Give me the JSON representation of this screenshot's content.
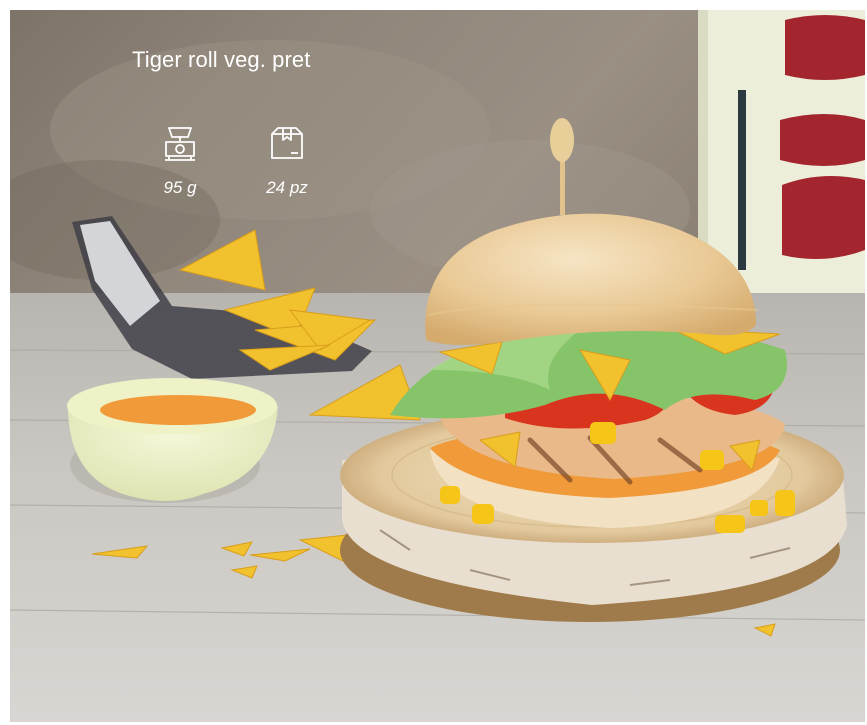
{
  "product": {
    "title": "Tiger roll veg. pret",
    "specs": [
      {
        "icon": "scale-icon",
        "value": "95 g"
      },
      {
        "icon": "box-icon",
        "value": "24 pz"
      }
    ]
  },
  "photo": {
    "subject": "burger-photo",
    "colors": {
      "wall": "#8d8478",
      "table": "#c9c6c0",
      "bun": "#efd4a8",
      "lettuce": "#86c46a",
      "tomato": "#d8341e",
      "chips": "#f2c12e",
      "sauce": "#f09a3a",
      "bowl": "#eef2c6",
      "sign_text": "#a3262f"
    }
  }
}
